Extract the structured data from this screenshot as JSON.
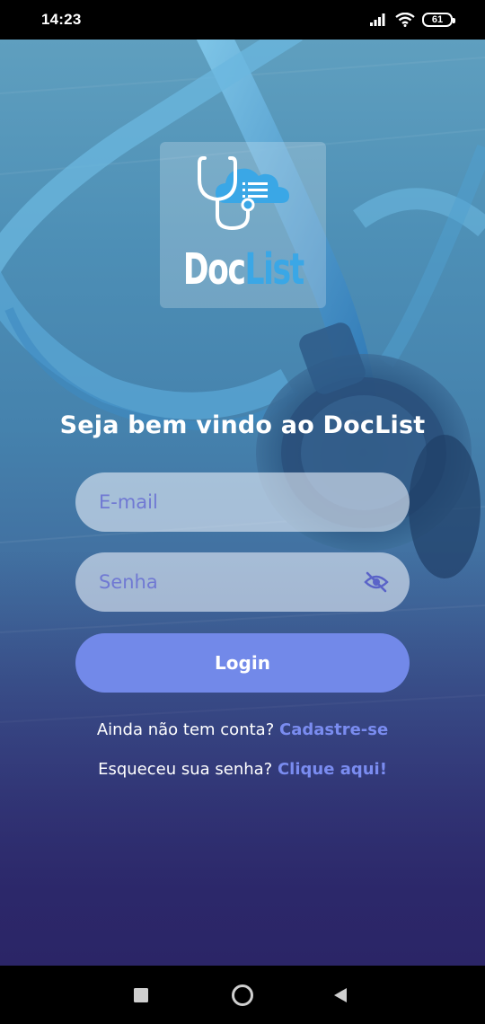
{
  "status_bar": {
    "time": "14:23",
    "battery": "61",
    "icons": [
      "signal-icon",
      "wifi-icon",
      "battery-icon"
    ]
  },
  "logo": {
    "word_part1": "Doc",
    "word_part2": "List",
    "icon": "stethoscope-cloud-icon"
  },
  "welcome": "Seja bem vindo ao DocList",
  "email": {
    "placeholder": "E-mail",
    "value": ""
  },
  "password": {
    "placeholder": "Senha",
    "value": "",
    "toggle_icon": "eye-off-icon"
  },
  "login_label": "Login",
  "signup": {
    "prompt": "Ainda não tem conta?",
    "link": "Cadastre-se"
  },
  "forgot": {
    "prompt": "Esqueceu sua senha?",
    "link": "Clique aqui!"
  },
  "nav": {
    "icons": [
      "recents-icon",
      "home-icon",
      "back-icon"
    ]
  },
  "colors": {
    "accent": "#7289e9",
    "link": "#7a8cf0",
    "logo_list": "#3aa7e6",
    "bg_top": "#5f9fbf",
    "bg_bottom": "#2a2566"
  }
}
